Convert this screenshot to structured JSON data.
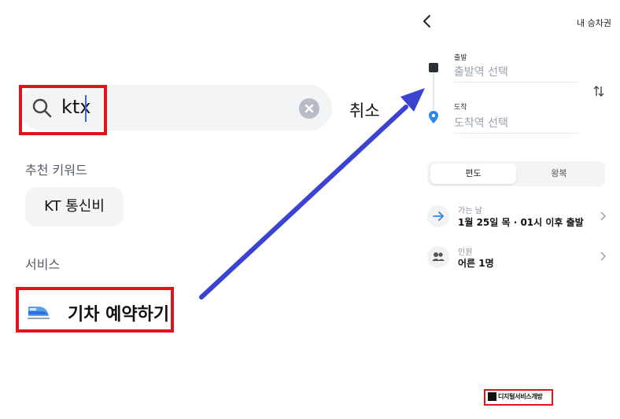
{
  "search_screen": {
    "query": "ktx",
    "cancel_label": "취소",
    "recommended_heading": "추천 키워드",
    "recommended_chip": "KT 통신비",
    "services_heading": "서비스",
    "train_service_label": "기차 예약하기",
    "icons": [
      "search-icon",
      "clear-icon",
      "train-icon"
    ]
  },
  "booking_screen": {
    "my_tickets_label": "내 승차권",
    "departure": {
      "label": "출발",
      "placeholder": "출발역 선택"
    },
    "arrival": {
      "label": "도착",
      "placeholder": "도착역 선택"
    },
    "trip_types": {
      "one_way": "편도",
      "round_trip": "왕복",
      "selected": "편도"
    },
    "date_row": {
      "label": "가는 날",
      "value": "1월 25일 목 · 01시 이후 출발"
    },
    "passenger_row": {
      "label": "인원",
      "value": "어른 1명"
    },
    "icons": [
      "back-icon",
      "swap-icon",
      "arrow-right-icon",
      "people-icon",
      "chevron-right-icon"
    ]
  },
  "watermark": "디지털서비스개방",
  "colors": {
    "highlight": "#e0141c",
    "arrow": "#3b44d0",
    "accent_blue": "#2f6de1"
  }
}
